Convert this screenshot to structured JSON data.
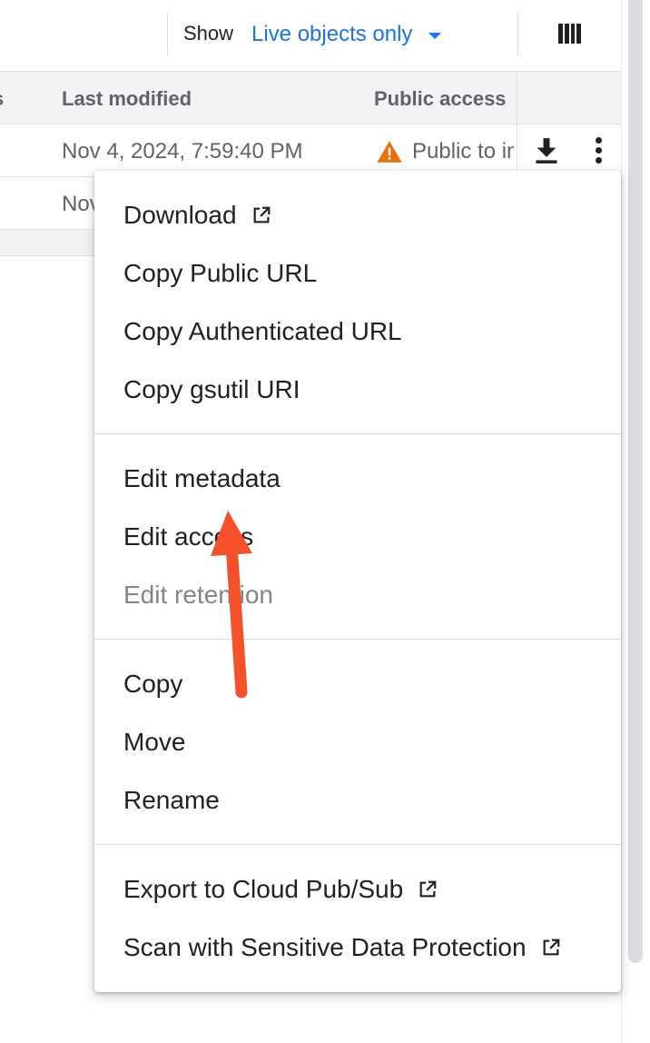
{
  "toolbar": {
    "show_label": "Show",
    "show_value": "Live objects only",
    "columns_icon": "view-columns-icon"
  },
  "table": {
    "headers": {
      "cut_column": "s",
      "last_modified": "Last modified",
      "public_access": "Public access"
    },
    "rows": [
      {
        "last_modified": "Nov 4, 2024, 7:59:40 PM",
        "public_access": "Public to internet"
      },
      {
        "last_modified": "Nov"
      }
    ]
  },
  "menu": {
    "items": [
      {
        "label": "Download"
      },
      {
        "label": "Copy Public URL"
      },
      {
        "label": "Copy Authenticated URL"
      },
      {
        "label": "Copy gsutil URI"
      },
      {
        "label": "Edit metadata"
      },
      {
        "label": "Edit access"
      },
      {
        "label": "Edit retention"
      },
      {
        "label": "Copy"
      },
      {
        "label": "Move"
      },
      {
        "label": "Rename"
      },
      {
        "label": "Export to Cloud Pub/Sub"
      },
      {
        "label": "Scan with Sensitive Data Protection"
      }
    ]
  },
  "colors": {
    "accent": "#1a73e8",
    "warning": "#e8710a",
    "annotation_arrow": "#f4502a",
    "disabled_text": "#80868b"
  }
}
